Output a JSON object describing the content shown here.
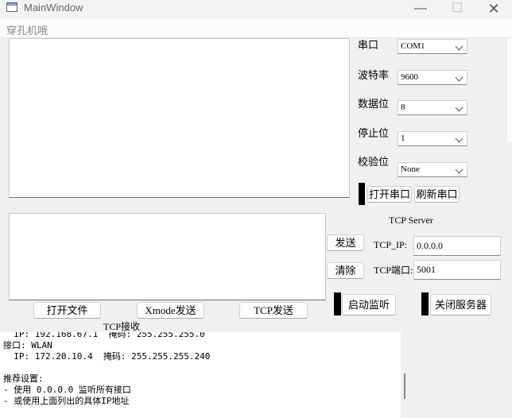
{
  "window": {
    "title": "MainWindow",
    "min_glyph": "—",
    "max_glyph": "☐",
    "close_glyph": "✕"
  },
  "menu": {
    "item": "穿孔机哦"
  },
  "serial": {
    "port": {
      "label": "串口",
      "value": "COM1"
    },
    "baud": {
      "label": "波特率",
      "value": "9600"
    },
    "databits": {
      "label": "数据位",
      "value": "8"
    },
    "stopbits": {
      "label": "停止位",
      "value": "1"
    },
    "parity": {
      "label": "校验位",
      "value": "None"
    },
    "open_button": "打开串口",
    "refresh_button": "刷新串口"
  },
  "send_panel": {
    "send_button": "发送",
    "clear_button": "清除"
  },
  "file_buttons": {
    "open_file": "打开文件",
    "xmodem_send": "Xmode发送",
    "tcp_send": "TCP发送"
  },
  "tcp_server": {
    "title": "TCP Server",
    "ip_label": "TCP_IP:",
    "ip_value": "0.0.0.0",
    "port_label": "TCP端口:",
    "port_value": "5001",
    "start_button": "启动监听",
    "stop_button": "关闭服务器"
  },
  "tcp_receive": {
    "label": "TCP接收",
    "log": "  IP: 192.168.67.1  掩码: 255.255.255.0\n接口: WLAN\n  IP: 172.20.10.4  掩码: 255.255.255.240\n\n推荐设置:\n- 使用 0.0.0.0 监听所有接口\n- 或使用上面列出的具体IP地址"
  }
}
